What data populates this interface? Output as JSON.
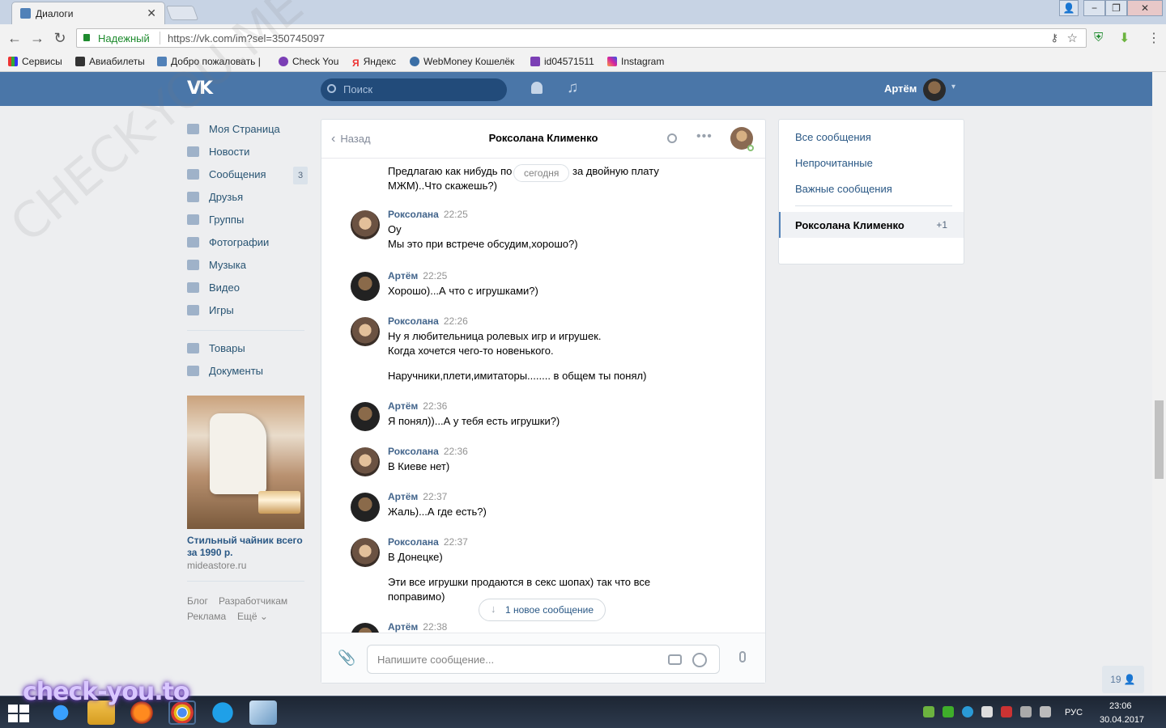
{
  "browser": {
    "tab_title": "Диалоги",
    "tab_close": "✕",
    "secure_label": "Надежный",
    "url": "https://vk.com/im?sel=350745097",
    "window_min": "−",
    "window_max": "❐",
    "window_close": "✕",
    "bookmarks": [
      "Сервисы",
      "Авиабилеты",
      "Добро пожаловать |",
      "Check You",
      "Яндекс",
      "WebMoney Кошелёк",
      "id04571511",
      "Instagram"
    ]
  },
  "vk_header": {
    "logo": "VK",
    "search_placeholder": "Поиск",
    "user_name": "Артём",
    "music_glyph": "♫",
    "caret": "▾"
  },
  "left_menu": {
    "items": [
      {
        "label": "Моя Страница",
        "icon": "home-icon"
      },
      {
        "label": "Новости",
        "icon": "news-icon"
      },
      {
        "label": "Сообщения",
        "icon": "messages-icon",
        "badge": "3"
      },
      {
        "label": "Друзья",
        "icon": "friends-icon"
      },
      {
        "label": "Группы",
        "icon": "groups-icon"
      },
      {
        "label": "Фотографии",
        "icon": "photo-icon"
      },
      {
        "label": "Музыка",
        "icon": "music-icon"
      },
      {
        "label": "Видео",
        "icon": "video-icon"
      },
      {
        "label": "Игры",
        "icon": "games-icon"
      }
    ],
    "extra": [
      {
        "label": "Товары",
        "icon": "market-icon"
      },
      {
        "label": "Документы",
        "icon": "docs-icon"
      }
    ],
    "ad_title": "Стильный чайник всего за 1990 р.",
    "ad_domain": "mideastore.ru",
    "footer": [
      "Блог",
      "Разработчикам",
      "Реклама",
      "Ещё ⌄"
    ]
  },
  "chat": {
    "back_label": "Назад",
    "peer_name": "Роксолана Клименко",
    "more_glyph": "•••",
    "date_pill": "сегодня",
    "first_text": [
      "Предлагаю как нибудь по",
      "за двойную плату",
      "МЖМ)..Что скажешь?)"
    ],
    "messages": [
      {
        "author": "Роксолана",
        "time": "22:25",
        "lines": [
          "Оу",
          "Мы это при встрече обсудим,хорошо?)"
        ],
        "gender": "f"
      },
      {
        "author": "Артём",
        "time": "22:25",
        "lines": [
          "Хорошо)...А что с игрушками?)"
        ],
        "gender": "m"
      },
      {
        "author": "Роксолана",
        "time": "22:26",
        "lines": [
          "Ну я любительница ролевых игр и игрушек.",
          "Когда хочется чего-то новенького.",
          "",
          "Наручники,плети,имитаторы........ в общем ты понял)"
        ],
        "gender": "f"
      },
      {
        "author": "Артём",
        "time": "22:36",
        "lines": [
          "Я понял))...А у тебя есть игрушки?)"
        ],
        "gender": "m"
      },
      {
        "author": "Роксолана",
        "time": "22:36",
        "lines": [
          "В Киеве нет)"
        ],
        "gender": "f"
      },
      {
        "author": "Артём",
        "time": "22:37",
        "lines": [
          "Жаль)...А где есть?)"
        ],
        "gender": "m"
      },
      {
        "author": "Роксолана",
        "time": "22:37",
        "lines": [
          "В Донецке)",
          "",
          "Эти все игрушки продаются в секс шопах) так что все",
          "поправимо)"
        ],
        "gender": "f"
      },
      {
        "author": "Артём",
        "time": "22:38",
        "lines": [],
        "gender": "m"
      }
    ],
    "new_message_button": "1 новое сообщение",
    "composer_placeholder": "Напишите сообщение..."
  },
  "right_panel": {
    "links": [
      "Все сообщения",
      "Непрочитанные",
      "Важные сообщения"
    ],
    "selected_name": "Роксолана Клименко",
    "selected_count": "+1"
  },
  "online_counter": "19 👤",
  "taskbar": {
    "language": "РУС",
    "time": "23:06",
    "date": "30.04.2017"
  },
  "watermark": {
    "logo": "check-you.to",
    "diagonal": "CHECK-YOU.ME"
  }
}
